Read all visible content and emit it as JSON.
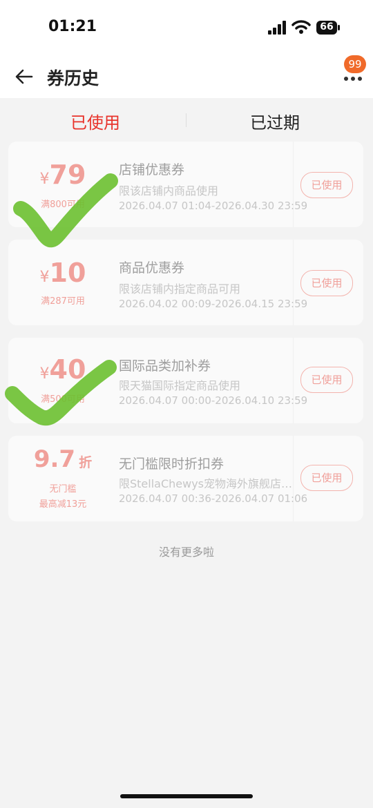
{
  "status_bar": {
    "time": "01:21",
    "battery": "66"
  },
  "header": {
    "title": "券历史",
    "badge": "99"
  },
  "tabs": [
    {
      "label": "已使用",
      "active": true
    },
    {
      "label": "已过期",
      "active": false
    }
  ],
  "coupons": [
    {
      "currency": "¥",
      "amount": "79",
      "condition": "满800可用",
      "title": "店铺优惠券",
      "description": "限该店铺内商品使用",
      "period": "2026.04.07 01:04-2026.04.30 23:59",
      "status": "已使用",
      "checked": true
    },
    {
      "currency": "¥",
      "amount": "10",
      "condition": "满287可用",
      "title": "商品优惠券",
      "description": "限该店铺内指定商品可用",
      "period": "2026.04.02 00:09-2026.04.15 23:59",
      "status": "已使用",
      "checked": false
    },
    {
      "currency": "¥",
      "amount": "40",
      "condition": "满500可用",
      "title": "国际品类加补券",
      "description": "限天猫国际指定商品使用",
      "period": "2026.04.07 00:00-2026.04.10 23:59",
      "status": "已使用",
      "checked": true
    },
    {
      "discount": "9.7",
      "discount_unit": "折",
      "condition_line1": "无门槛",
      "condition_line2": "最高减13元",
      "title": "无门槛限时折扣券",
      "description": "限StellaChewys宠物海外旗舰店…",
      "period": "2026.04.07 00:36-2026.04.07 01:06",
      "status": "已使用",
      "checked": false
    }
  ],
  "footer_text": "没有更多啦",
  "colors": {
    "accent": "#e8322a",
    "coupon_faded": "#f0a09a",
    "check_green": "#6cc030",
    "badge": "#f06a2a"
  }
}
